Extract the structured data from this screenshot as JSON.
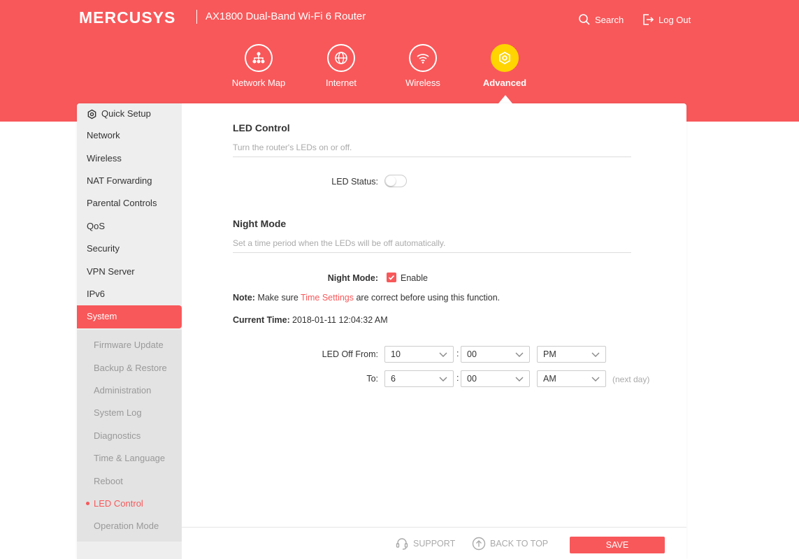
{
  "header": {
    "brand": "MERCUSYS",
    "model": "AX1800 Dual-Band Wi-Fi 6 Router",
    "search_label": "Search",
    "logout_label": "Log Out"
  },
  "nav": {
    "items": [
      {
        "label": "Network Map",
        "icon": "network-map-icon"
      },
      {
        "label": "Internet",
        "icon": "globe-icon"
      },
      {
        "label": "Wireless",
        "icon": "wifi-icon"
      },
      {
        "label": "Advanced",
        "icon": "gear-icon",
        "active": true
      }
    ]
  },
  "sidebar": {
    "items": [
      {
        "label": "Quick Setup",
        "icon": "gear-icon"
      },
      {
        "label": "Network"
      },
      {
        "label": "Wireless"
      },
      {
        "label": "NAT Forwarding"
      },
      {
        "label": "Parental Controls"
      },
      {
        "label": "QoS"
      },
      {
        "label": "Security"
      },
      {
        "label": "VPN Server"
      },
      {
        "label": "IPv6"
      },
      {
        "label": "System",
        "active": true
      }
    ],
    "sub_items": [
      {
        "label": "Firmware Update"
      },
      {
        "label": "Backup & Restore"
      },
      {
        "label": "Administration"
      },
      {
        "label": "System Log"
      },
      {
        "label": "Diagnostics"
      },
      {
        "label": "Time & Language"
      },
      {
        "label": "Reboot"
      },
      {
        "label": "LED Control",
        "active": true
      },
      {
        "label": "Operation Mode"
      }
    ]
  },
  "led_control": {
    "title": "LED Control",
    "description": "Turn the router's LEDs on or off.",
    "status_label": "LED Status:",
    "status_on": false
  },
  "night_mode": {
    "title": "Night Mode",
    "description": "Set a time period when the LEDs will be off automatically.",
    "label": "Night Mode:",
    "enable_label": "Enable",
    "enabled": true,
    "note_prefix": "Note:",
    "note_before": "Make sure",
    "note_link": "Time Settings",
    "note_after": "are correct before using this function.",
    "current_time_label": "Current Time:",
    "current_time_value": "2018-01-11 12:04:32 AM",
    "off_from_label": "LED Off From:",
    "to_label": "To:",
    "colon": ":",
    "from_hour": "10",
    "from_minute": "00",
    "from_ampm": "PM",
    "to_hour": "6",
    "to_minute": "00",
    "to_ampm": "AM",
    "next_day": "(next day)"
  },
  "footer": {
    "support_label": "SUPPORT",
    "back_to_top_label": "BACK TO TOP",
    "save_label": "SAVE"
  },
  "colors": {
    "brand": "#f8585a",
    "active_nav": "#ffd400"
  }
}
